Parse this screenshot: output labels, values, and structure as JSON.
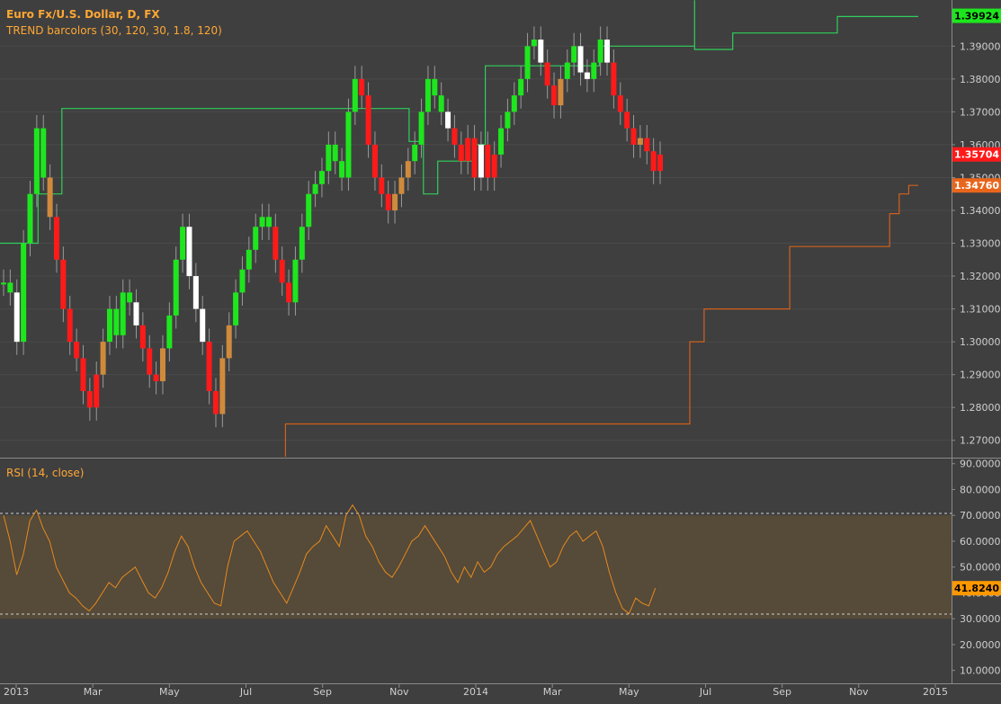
{
  "colors": {
    "background": "#3f3f3f",
    "pane_border": "#8a8a8a",
    "grid": "#4a4a4a",
    "axis_text": "#cfcfcf",
    "title": "#ffa733",
    "green": "#1ee61e",
    "red": "#ff1a1a",
    "orange_bar": "#d08a3c",
    "white_bar": "#ffffff",
    "upper_line": "#2fcf5a",
    "lower_line": "#d2601c",
    "rsi_line": "#e48a1d",
    "rsi_band_fill": "#564a39"
  },
  "header": {
    "title": "Euro Fx/U.S. Dollar, D, FX",
    "indicator": "TREND barcolors (30, 120, 30, 1.8, 120)"
  },
  "rsi_panel": {
    "label": "RSI (14, close)"
  },
  "price_axis": {
    "ticks": [
      "1.39000",
      "1.38000",
      "1.37000",
      "1.36000",
      "1.35000",
      "1.34000",
      "1.33000",
      "1.32000",
      "1.31000",
      "1.30000",
      "1.29000",
      "1.28000",
      "1.27000"
    ],
    "badges": [
      {
        "text": "1.39924",
        "color": "#1ee61e",
        "text_color": "#000000"
      },
      {
        "text": "1.35704",
        "color": "#ff1a1a",
        "text_color": "#ffffff"
      },
      {
        "text": "1.34760",
        "color": "#e8661c",
        "text_color": "#ffffff"
      }
    ]
  },
  "rsi_axis": {
    "ticks": [
      "90.0000",
      "80.0000",
      "70.0000",
      "60.0000",
      "50.0000",
      "40.0000",
      "30.0000",
      "20.0000",
      "10.0000"
    ],
    "badge": {
      "text": "41.8240",
      "color": "#ff9800",
      "text_color": "#000000"
    }
  },
  "time_axis": {
    "labels": [
      "2013",
      "Mar",
      "May",
      "Jul",
      "Sep",
      "Nov",
      "2014",
      "Mar",
      "May",
      "Jul",
      "Sep",
      "Nov",
      "2015"
    ]
  },
  "chart_data": {
    "type": "candlestick",
    "title": "Euro Fx/U.S. Dollar, D, FX",
    "price_range": [
      1.265,
      1.4035
    ],
    "rsi_range": [
      5,
      92
    ],
    "rsi_bands": [
      30,
      70
    ],
    "bars": [
      {
        "c": 1.318,
        "col": "g"
      },
      {
        "c": 1.315,
        "col": "g"
      },
      {
        "c": 1.3,
        "col": "w"
      },
      {
        "c": 1.33,
        "col": "g"
      },
      {
        "c": 1.345,
        "col": "g"
      },
      {
        "c": 1.365,
        "col": "g"
      },
      {
        "c": 1.35,
        "col": "g"
      },
      {
        "c": 1.338,
        "col": "o"
      },
      {
        "c": 1.325,
        "col": "r"
      },
      {
        "c": 1.31,
        "col": "r"
      },
      {
        "c": 1.3,
        "col": "r"
      },
      {
        "c": 1.295,
        "col": "r"
      },
      {
        "c": 1.285,
        "col": "r"
      },
      {
        "c": 1.28,
        "col": "r"
      },
      {
        "c": 1.29,
        "col": "r"
      },
      {
        "c": 1.3,
        "col": "o"
      },
      {
        "c": 1.31,
        "col": "g"
      },
      {
        "c": 1.302,
        "col": "g"
      },
      {
        "c": 1.315,
        "col": "g"
      },
      {
        "c": 1.312,
        "col": "g"
      },
      {
        "c": 1.305,
        "col": "w"
      },
      {
        "c": 1.298,
        "col": "r"
      },
      {
        "c": 1.29,
        "col": "r"
      },
      {
        "c": 1.288,
        "col": "r"
      },
      {
        "c": 1.298,
        "col": "o"
      },
      {
        "c": 1.308,
        "col": "g"
      },
      {
        "c": 1.325,
        "col": "g"
      },
      {
        "c": 1.335,
        "col": "g"
      },
      {
        "c": 1.32,
        "col": "w"
      },
      {
        "c": 1.31,
        "col": "w"
      },
      {
        "c": 1.3,
        "col": "w"
      },
      {
        "c": 1.285,
        "col": "r"
      },
      {
        "c": 1.278,
        "col": "r"
      },
      {
        "c": 1.295,
        "col": "o"
      },
      {
        "c": 1.305,
        "col": "o"
      },
      {
        "c": 1.315,
        "col": "g"
      },
      {
        "c": 1.322,
        "col": "g"
      },
      {
        "c": 1.328,
        "col": "g"
      },
      {
        "c": 1.335,
        "col": "g"
      },
      {
        "c": 1.338,
        "col": "g"
      },
      {
        "c": 1.335,
        "col": "g"
      },
      {
        "c": 1.325,
        "col": "r"
      },
      {
        "c": 1.318,
        "col": "r"
      },
      {
        "c": 1.312,
        "col": "r"
      },
      {
        "c": 1.325,
        "col": "g"
      },
      {
        "c": 1.335,
        "col": "g"
      },
      {
        "c": 1.345,
        "col": "g"
      },
      {
        "c": 1.348,
        "col": "g"
      },
      {
        "c": 1.352,
        "col": "g"
      },
      {
        "c": 1.36,
        "col": "g"
      },
      {
        "c": 1.355,
        "col": "g"
      },
      {
        "c": 1.35,
        "col": "g"
      },
      {
        "c": 1.37,
        "col": "g"
      },
      {
        "c": 1.38,
        "col": "g"
      },
      {
        "c": 1.375,
        "col": "r"
      },
      {
        "c": 1.36,
        "col": "r"
      },
      {
        "c": 1.35,
        "col": "r"
      },
      {
        "c": 1.345,
        "col": "r"
      },
      {
        "c": 1.34,
        "col": "r"
      },
      {
        "c": 1.345,
        "col": "o"
      },
      {
        "c": 1.35,
        "col": "o"
      },
      {
        "c": 1.355,
        "col": "o"
      },
      {
        "c": 1.36,
        "col": "g"
      },
      {
        "c": 1.37,
        "col": "g"
      },
      {
        "c": 1.38,
        "col": "g"
      },
      {
        "c": 1.375,
        "col": "g"
      },
      {
        "c": 1.37,
        "col": "g"
      },
      {
        "c": 1.365,
        "col": "w"
      },
      {
        "c": 1.36,
        "col": "r"
      },
      {
        "c": 1.355,
        "col": "r"
      },
      {
        "c": 1.362,
        "col": "r"
      },
      {
        "c": 1.35,
        "col": "r"
      },
      {
        "c": 1.36,
        "col": "w"
      },
      {
        "c": 1.35,
        "col": "r"
      },
      {
        "c": 1.357,
        "col": "r"
      },
      {
        "c": 1.365,
        "col": "g"
      },
      {
        "c": 1.37,
        "col": "g"
      },
      {
        "c": 1.375,
        "col": "g"
      },
      {
        "c": 1.38,
        "col": "g"
      },
      {
        "c": 1.39,
        "col": "g"
      },
      {
        "c": 1.392,
        "col": "g"
      },
      {
        "c": 1.385,
        "col": "w"
      },
      {
        "c": 1.378,
        "col": "r"
      },
      {
        "c": 1.372,
        "col": "r"
      },
      {
        "c": 1.38,
        "col": "o"
      },
      {
        "c": 1.385,
        "col": "g"
      },
      {
        "c": 1.39,
        "col": "g"
      },
      {
        "c": 1.382,
        "col": "w"
      },
      {
        "c": 1.38,
        "col": "w"
      },
      {
        "c": 1.385,
        "col": "g"
      },
      {
        "c": 1.392,
        "col": "g"
      },
      {
        "c": 1.385,
        "col": "w"
      },
      {
        "c": 1.375,
        "col": "r"
      },
      {
        "c": 1.37,
        "col": "r"
      },
      {
        "c": 1.365,
        "col": "r"
      },
      {
        "c": 1.36,
        "col": "r"
      },
      {
        "c": 1.362,
        "col": "o"
      },
      {
        "c": 1.358,
        "col": "r"
      },
      {
        "c": 1.352,
        "col": "r"
      },
      {
        "c": 1.357,
        "col": "r"
      }
    ],
    "upper_line": [
      [
        0,
        1.33
      ],
      [
        0.04,
        1.33
      ],
      [
        0.04,
        1.345
      ],
      [
        0.065,
        1.345
      ],
      [
        0.065,
        1.371
      ],
      [
        0.43,
        1.371
      ],
      [
        0.43,
        1.361
      ],
      [
        0.445,
        1.361
      ],
      [
        0.445,
        1.345
      ],
      [
        0.46,
        1.345
      ],
      [
        0.46,
        1.355
      ],
      [
        0.5,
        1.355
      ],
      [
        0.5,
        1.36
      ],
      [
        0.51,
        1.36
      ],
      [
        0.51,
        1.384
      ],
      [
        0.63,
        1.384
      ],
      [
        0.63,
        1.39
      ],
      [
        0.73,
        1.39
      ],
      [
        0.73,
        1.404
      ],
      [
        0.73,
        1.389
      ],
      [
        0.77,
        1.389
      ],
      [
        0.77,
        1.394
      ],
      [
        0.88,
        1.394
      ],
      [
        0.88,
        1.399
      ],
      [
        0.965,
        1.399
      ]
    ],
    "lower_line": [
      [
        0.3,
        1.265
      ],
      [
        0.3,
        1.275
      ],
      [
        0.725,
        1.275
      ],
      [
        0.725,
        1.3
      ],
      [
        0.74,
        1.3
      ],
      [
        0.74,
        1.31
      ],
      [
        0.83,
        1.31
      ],
      [
        0.83,
        1.329
      ],
      [
        0.935,
        1.329
      ],
      [
        0.935,
        1.339
      ],
      [
        0.945,
        1.339
      ],
      [
        0.945,
        1.345
      ],
      [
        0.955,
        1.345
      ],
      [
        0.955,
        1.3476
      ],
      [
        0.965,
        1.3476
      ]
    ],
    "rsi_values": [
      70,
      60,
      47,
      55,
      68,
      72,
      65,
      60,
      50,
      45,
      40,
      38,
      35,
      33,
      36,
      40,
      44,
      42,
      46,
      48,
      50,
      45,
      40,
      38,
      42,
      48,
      56,
      62,
      58,
      50,
      44,
      40,
      36,
      35,
      50,
      60,
      62,
      64,
      60,
      56,
      50,
      44,
      40,
      36,
      42,
      48,
      55,
      58,
      60,
      66,
      62,
      58,
      70,
      74,
      70,
      62,
      58,
      52,
      48,
      46,
      50,
      55,
      60,
      62,
      66,
      62,
      58,
      54,
      48,
      44,
      50,
      46,
      52,
      48,
      50,
      55,
      58,
      60,
      62,
      65,
      68,
      62,
      56,
      50,
      52,
      58,
      62,
      64,
      60,
      62,
      64,
      58,
      48,
      40,
      34,
      32,
      38,
      36,
      35,
      41.824
    ]
  }
}
